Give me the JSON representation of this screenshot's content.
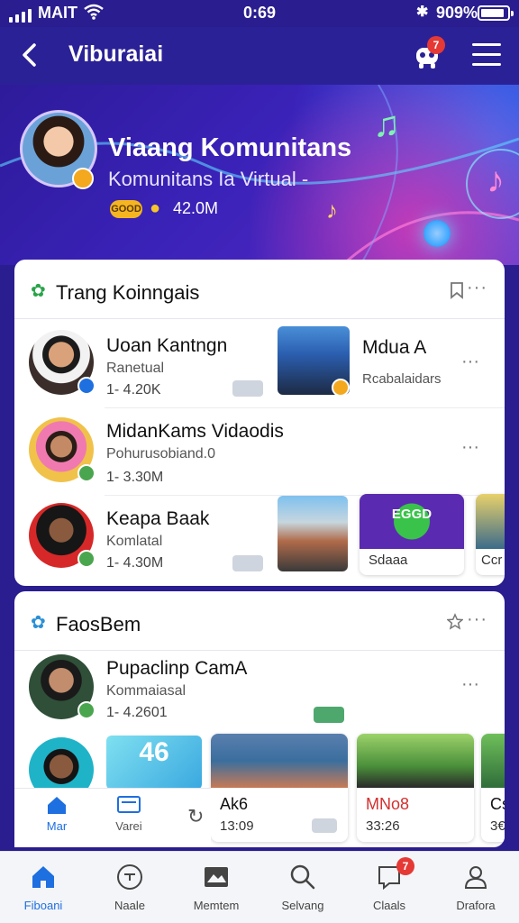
{
  "status_bar": {
    "carrier": "MAIT",
    "time": "0:69",
    "battery": "909%"
  },
  "nav": {
    "title": "Viburaiai",
    "notification_count": "7"
  },
  "hero": {
    "title": "Viaang Komunitans",
    "subtitle": "Komunitans Ia Virtual -",
    "tier_badge": "GOOD",
    "stat": "42.0M"
  },
  "section1": {
    "title": "Trang Koinngais",
    "rows": [
      {
        "name": "Uoan Kantngn",
        "sub": "Ranetual",
        "count": "1- 4.20K"
      },
      {
        "name": "MidanKams Vidaodis",
        "sub": "Pohurusobiand.0",
        "count": "1- 3.30M"
      },
      {
        "name": "Keapa Baak",
        "sub": "Komlatal",
        "count": "1- 4.30M"
      }
    ],
    "side_item": {
      "name": "Mdua A",
      "sub": "Rcabalaidars"
    },
    "thumb_labels": [
      "Sdaaa",
      "Ccr"
    ],
    "ego_banner": "EGGD"
  },
  "section2": {
    "title": "FaosBem",
    "row": {
      "name": "Pupaclinp CamA",
      "sub": "Kommaiasal",
      "count": "1- 4.2601"
    },
    "tile_number": "46",
    "videos": [
      {
        "title": "Ak6",
        "time": "13:09"
      },
      {
        "title": "MNo8",
        "time": "33:26"
      },
      {
        "title": "Cs",
        "time": "3€"
      }
    ]
  },
  "inner_tabs": [
    {
      "label": "Mar",
      "icon": "home-icon"
    },
    {
      "label": "Varei",
      "icon": "tv-icon"
    }
  ],
  "bottom_nav": {
    "items": [
      {
        "label": "Fiboani",
        "icon": "home-icon"
      },
      {
        "label": "Naale",
        "icon": "face-icon"
      },
      {
        "label": "Memtem",
        "icon": "news-icon"
      },
      {
        "label": "Selvang",
        "icon": "search-icon"
      },
      {
        "label": "Claals",
        "icon": "chat-icon"
      },
      {
        "label": "Drafora",
        "icon": "profile-icon"
      }
    ],
    "chat_badge": "7"
  },
  "colors": {
    "nav_bg": "#2b2196",
    "accent": "#1e6fe0",
    "badge_red": "#e53935",
    "gold": "#f5b521"
  }
}
